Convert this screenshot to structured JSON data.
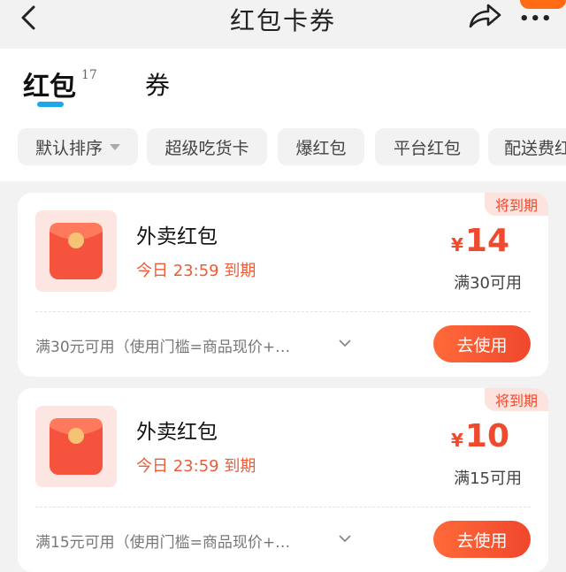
{
  "header": {
    "title": "红包卡券"
  },
  "tabs": [
    {
      "label": "红包",
      "count": "17"
    },
    {
      "label": "券"
    }
  ],
  "filters": [
    {
      "label": "默认排序"
    },
    {
      "label": "超级吃货卡"
    },
    {
      "label": "爆红包"
    },
    {
      "label": "平台红包"
    },
    {
      "label": "配送费红包"
    }
  ],
  "cards": [
    {
      "badge": "将到期",
      "title": "外卖红包",
      "expire": "今日 23:59 到期",
      "currency": "¥",
      "amount": "14",
      "condition": "满30可用",
      "rule": "满30元可用（使用门槛=商品现价+…",
      "button": "去使用"
    },
    {
      "badge": "将到期",
      "title": "外卖红包",
      "expire": "今日 23:59 到期",
      "currency": "¥",
      "amount": "10",
      "condition": "满15可用",
      "rule": "满15元可用（使用门槛=商品现价+…",
      "button": "去使用"
    }
  ],
  "colors": {
    "accent": "#f04a2e",
    "tab_underline": "#1ba7e8",
    "corner_badge": "#ff6a12"
  }
}
